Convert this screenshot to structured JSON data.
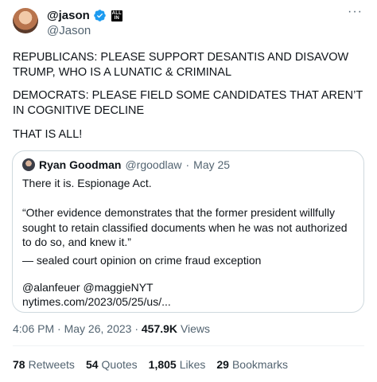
{
  "author": {
    "display_name": "@jason",
    "handle": "@Jason",
    "affiliate_badge": "ALL IN",
    "verified_color": "#1d9bf0"
  },
  "menu": {
    "more_label": "···"
  },
  "tweet_lines": [
    "REPUBLICANS: PLEASE SUPPORT DESANTIS AND DISAVOW TRUMP, WHO IS A LUNATIC & CRIMINAL",
    "DEMOCRATS: PLEASE FIELD SOME CANDIDATES THAT AREN’T IN COGNITIVE DECLINE",
    "THAT IS ALL!"
  ],
  "quoted": {
    "name": "Ryan Goodman",
    "handle": "@rgoodlaw",
    "separator": "·",
    "date": "May 25",
    "lines": [
      "There it is. Espionage Act.",
      "“Other evidence demonstrates that the former president willfully sought to retain classified documents when he was not authorized to do so, and knew it.”",
      "— sealed court opinion on crime fraud exception",
      "@alanfeuer @maggieNYT",
      "nytimes.com/2023/05/25/us/..."
    ]
  },
  "meta": {
    "time": "4:06 PM",
    "separator": "·",
    "date": "May 26, 2023",
    "views_count": "457.9K",
    "views_label": "Views"
  },
  "stats": [
    {
      "count": "78",
      "label": "Retweets"
    },
    {
      "count": "54",
      "label": "Quotes"
    },
    {
      "count": "1,805",
      "label": "Likes"
    },
    {
      "count": "29",
      "label": "Bookmarks"
    }
  ]
}
